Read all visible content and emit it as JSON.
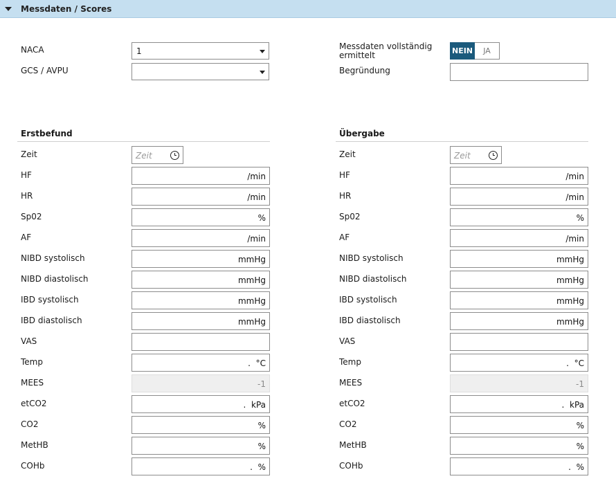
{
  "section": {
    "title": "Messdaten / Scores"
  },
  "top": {
    "naca": {
      "label": "NACA",
      "value": "1"
    },
    "gcs": {
      "label": "GCS / AVPU",
      "value": ""
    },
    "complete": {
      "label": "Messdaten vollständig ermittelt",
      "options": [
        "NEIN",
        "JA"
      ],
      "selected": "NEIN"
    },
    "reason": {
      "label": "Begründung",
      "value": ""
    }
  },
  "erstbefund": {
    "title": "Erstbefund",
    "time": {
      "label": "Zeit",
      "placeholder": "Zeit"
    },
    "rows": [
      {
        "label": "HF",
        "unit": "/min"
      },
      {
        "label": "HR",
        "unit": "/min"
      },
      {
        "label": "Sp02",
        "unit": "%"
      },
      {
        "label": "AF",
        "unit": "/min"
      },
      {
        "label": "NIBD systolisch",
        "unit": "mmHg"
      },
      {
        "label": "NIBD diastolisch",
        "unit": "mmHg"
      },
      {
        "label": "IBD systolisch",
        "unit": "mmHg"
      },
      {
        "label": "IBD diastolisch",
        "unit": "mmHg"
      },
      {
        "label": "VAS",
        "unit": ""
      },
      {
        "label": "Temp",
        "unit": ".  °C"
      },
      {
        "label": "MEES",
        "unit": "-1"
      },
      {
        "label": "etCO2",
        "unit": ".  kPa"
      },
      {
        "label": "CO2",
        "unit": "%"
      },
      {
        "label": "MetHB",
        "unit": "%"
      },
      {
        "label": "COHb",
        "unit": ".  %"
      }
    ]
  },
  "uebergabe": {
    "title": "Übergabe",
    "time": {
      "label": "Zeit",
      "placeholder": "Zeit"
    },
    "rows": [
      {
        "label": "HF",
        "unit": "/min"
      },
      {
        "label": "HR",
        "unit": "/min"
      },
      {
        "label": "Sp02",
        "unit": "%"
      },
      {
        "label": "AF",
        "unit": "/min"
      },
      {
        "label": "NIBD systolisch",
        "unit": "mmHg"
      },
      {
        "label": "NIBD diastolisch",
        "unit": "mmHg"
      },
      {
        "label": "IBD systolisch",
        "unit": "mmHg"
      },
      {
        "label": "IBD diastolisch",
        "unit": "mmHg"
      },
      {
        "label": "VAS",
        "unit": ""
      },
      {
        "label": "Temp",
        "unit": ".  °C"
      },
      {
        "label": "MEES",
        "unit": "-1"
      },
      {
        "label": "etCO2",
        "unit": ".  kPa"
      },
      {
        "label": "CO2",
        "unit": "%"
      },
      {
        "label": "MetHB",
        "unit": "%"
      },
      {
        "label": "COHb",
        "unit": ".  %"
      }
    ]
  }
}
